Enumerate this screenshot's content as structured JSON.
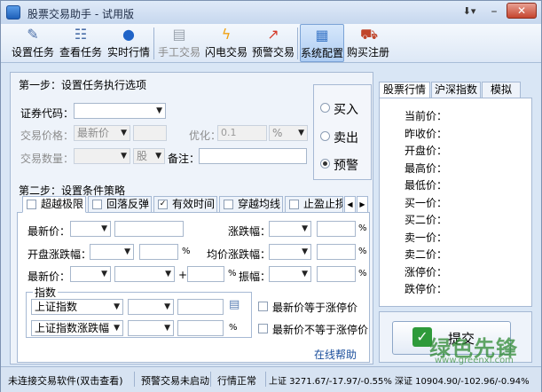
{
  "window": {
    "title": "股票交易助手 - 试用版"
  },
  "toolbar": {
    "items": [
      {
        "label": "设置任务",
        "icon": "settings-task-icon"
      },
      {
        "label": "查看任务",
        "icon": "view-task-icon"
      },
      {
        "label": "实时行情",
        "icon": "realtime-quote-icon"
      },
      {
        "label": "手工交易",
        "icon": "manual-trade-icon"
      },
      {
        "label": "闪电交易",
        "icon": "lightning-icon"
      },
      {
        "label": "预警交易",
        "icon": "alert-trade-icon"
      },
      {
        "label": "系统配置",
        "icon": "system-config-icon"
      },
      {
        "label": "购买注册",
        "icon": "cart-icon"
      }
    ]
  },
  "step1": {
    "title": "第一步：设置任务执行选项",
    "code_label": "证券代码：",
    "price_label": "交易价格：",
    "price_type": "最新价",
    "optimize_label": "优化：",
    "optimize_value": "0.1",
    "optimize_unit": "%",
    "qty_label": "交易数量：",
    "qty_unit": "股",
    "note_label": "备注：",
    "actions": [
      "买入",
      "卖出",
      "预警"
    ],
    "selected_action": "预警"
  },
  "step2": {
    "title": "第二步：设置条件策略",
    "tabs": [
      "超越极限",
      "回落反弹",
      "有效时间",
      "穿越均线",
      "止盈止损"
    ],
    "checked_tabs": [
      "有效时间"
    ],
    "latest_label": "最新价：",
    "change_label": "涨跌幅：",
    "open_change_label": "开盘涨跌幅：",
    "avg_change_label": "均价涨跌幅：",
    "latest_label2": "最新价：",
    "plus": "+",
    "amplitude_label": "振幅：",
    "pct": "%",
    "index_group": "指数",
    "index1": "上证指数",
    "index2": "上证指数涨跌幅",
    "limit_up": "最新价等于涨停价",
    "not_limit_up": "最新价不等于涨停价",
    "help": "在线帮助"
  },
  "quote": {
    "tabs": [
      "股票行情",
      "沪深指数",
      "模拟"
    ],
    "fields": [
      "当前价：",
      "昨收价：",
      "开盘价：",
      "最高价：",
      "最低价：",
      "买一价：",
      "买二价：",
      "卖一价：",
      "卖二价：",
      "涨停价：",
      "跌停价："
    ]
  },
  "submit": {
    "label": "提交"
  },
  "watermark": {
    "text": "绿色先锋",
    "url": "www.greenxf.com"
  },
  "status": {
    "conn": "未连接交易软件(双击查看)",
    "alert": "预警交易未启动",
    "market": "行情正常",
    "sh": "上证 3271.67/-17.97/-0.55%",
    "sz": "深证 10904.90/-102.96/-0.94%"
  },
  "colors": {
    "accent": "#3c78c8",
    "link": "#1b4f9c",
    "submit_check": "#2e9a3a"
  }
}
